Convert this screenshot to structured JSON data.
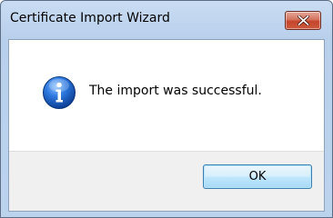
{
  "window": {
    "title": "Certificate Import Wizard"
  },
  "message": {
    "text": "The import was successful.",
    "icon": "information-icon"
  },
  "buttons": {
    "ok_label": "OK",
    "close_icon": "close-icon"
  },
  "colors": {
    "titlebar": "#c9dcf2",
    "close_button": "#c4452c",
    "info_icon": "#1f5fb8",
    "button_area": "#f0f0f0",
    "ok_button_border": "#3c7fb1"
  }
}
